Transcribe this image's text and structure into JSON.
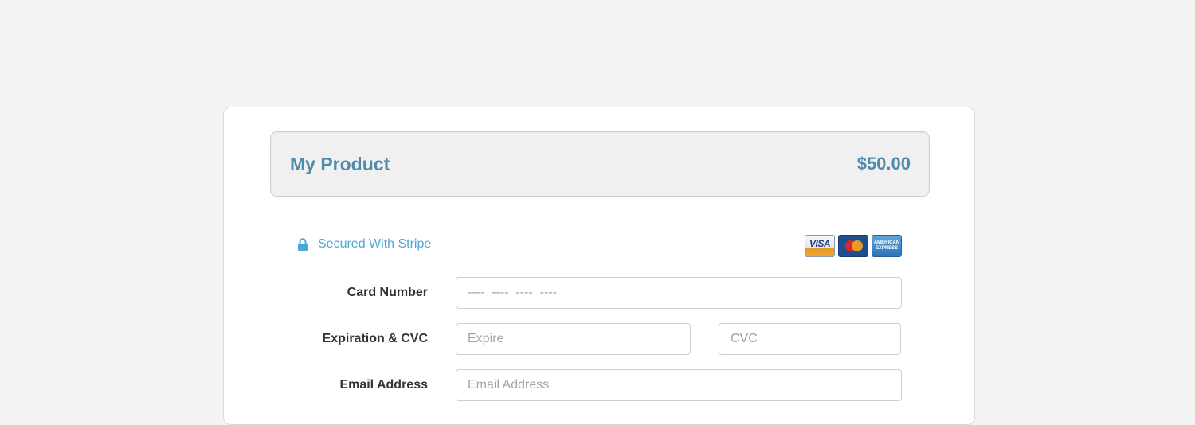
{
  "product": {
    "name": "My Product",
    "price": "$50.00"
  },
  "security": {
    "text": "Secured With Stripe",
    "icon": "lock-icon",
    "accent_color": "#4aa8d6"
  },
  "accepted_cards": [
    {
      "name": "visa-icon",
      "label": "VISA"
    },
    {
      "name": "mastercard-icon",
      "label": ""
    },
    {
      "name": "amex-icon",
      "label": "AMERICAN EXPRESS"
    }
  ],
  "form": {
    "card_number": {
      "label": "Card Number",
      "placeholder": "----  ----  ----  ----"
    },
    "expiration_cvc": {
      "label": "Expiration & CVC",
      "expire_placeholder": "Expire",
      "cvc_placeholder": "CVC"
    },
    "email": {
      "label": "Email Address",
      "placeholder": "Email Address"
    }
  },
  "colors": {
    "brand": "#4f8bab",
    "background": "#f3f3f3"
  }
}
